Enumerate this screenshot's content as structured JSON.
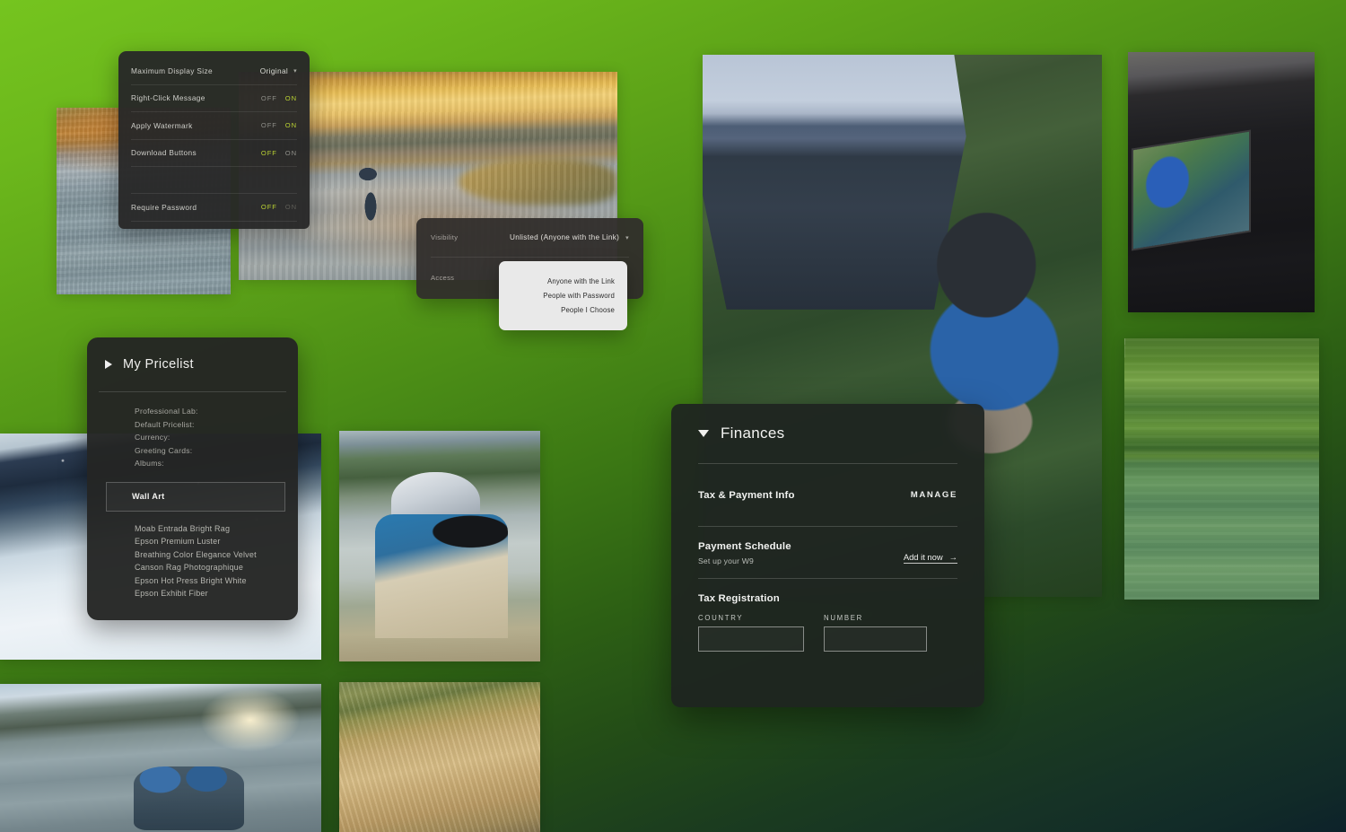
{
  "theme": {
    "bg_top_left": "#6cb81c",
    "bg_bottom_right": "#0d222a",
    "accent_on": "#b9d133",
    "panel_dark": "#282828",
    "panel_finances": "#1e2420"
  },
  "display_settings": {
    "rows": [
      {
        "label": "Maximum Display Size",
        "type": "select",
        "value": "Original",
        "chevron": "chevron-down-icon"
      },
      {
        "label": "Right-Click Message",
        "type": "toggle",
        "off_label": "OFF",
        "on_label": "ON",
        "selected": "ON"
      },
      {
        "label": "Apply Watermark",
        "type": "toggle",
        "off_label": "OFF",
        "on_label": "ON",
        "selected": "ON"
      },
      {
        "label": "Download Buttons",
        "type": "toggle",
        "off_label": "OFF",
        "on_label": "ON",
        "selected": "OFF"
      },
      {
        "label": "Require Password",
        "type": "toggle",
        "off_label": "OFF",
        "on_label": "ON",
        "selected": "OFF"
      }
    ]
  },
  "visibility_card": {
    "visibility_label": "Visibility",
    "visibility_value": "Unlisted (Anyone with the Link)",
    "visibility_chevron": "chevron-down-icon",
    "access_label": "Access"
  },
  "access_dropdown": {
    "options": [
      "Anyone with the Link",
      "People with Password",
      "People I Choose"
    ]
  },
  "pricelist": {
    "title": "My Pricelist",
    "disclosure_icon": "triangle-right-icon",
    "fields": [
      "Professional Lab:",
      "Default Pricelist:",
      "Currency:",
      "Greeting Cards:",
      "Albums:"
    ],
    "active_tab": "Wall Art",
    "papers": [
      "Moab Entrada Bright Rag",
      "Epson Premium Luster",
      "Breathing Color Elegance Velvet",
      "Canson Rag Photographique",
      "Epson Hot Press Bright White",
      "Epson Exhibit Fiber"
    ]
  },
  "finances": {
    "title": "Finances",
    "disclosure_icon": "triangle-down-icon",
    "tax_payment_info_label": "Tax & Payment Info",
    "manage_label": "MANAGE",
    "payment_schedule_label": "Payment Schedule",
    "payment_schedule_sub": "Set up your W9",
    "add_it_now_label": "Add it now",
    "add_it_now_arrow": "arrow-right-icon",
    "tax_registration_label": "Tax Registration",
    "country_label": "COUNTRY",
    "country_value": "",
    "number_label": "NUMBER",
    "number_value": ""
  },
  "photos": [
    {
      "name": "river-left",
      "alt": "River bank at golden hour"
    },
    {
      "name": "fly-fishing",
      "alt": "Fly fisherman wading a river at sunset"
    },
    {
      "name": "cyclist",
      "alt": "Mountain biker on trail with photographer kneeling"
    },
    {
      "name": "laptop",
      "alt": "Laptop on workbench showing mountain bike photo"
    },
    {
      "name": "reflection",
      "alt": "Forest trees reflected in still green lake"
    },
    {
      "name": "snow",
      "alt": "Winter snow scene with gloved hands"
    },
    {
      "name": "photographer",
      "alt": "Photographer in waders shooting with DSLR"
    },
    {
      "name": "boat",
      "alt": "Two anglers in a boat at sunrise on a lake"
    },
    {
      "name": "grass",
      "alt": "Golden grass hillside in warm light"
    }
  ]
}
